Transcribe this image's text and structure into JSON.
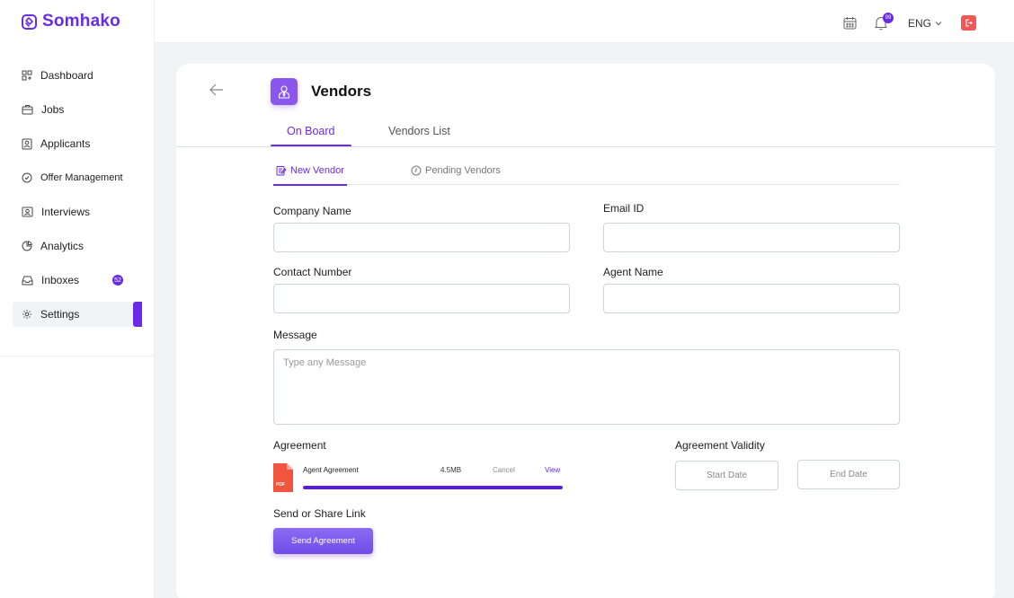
{
  "brand": {
    "name": "Somhako",
    "color": "#6A2BE8"
  },
  "sidebar": {
    "items": [
      {
        "label": "Dashboard",
        "icon": "dashboard-icon"
      },
      {
        "label": "Jobs",
        "icon": "briefcase-icon"
      },
      {
        "label": "Applicants",
        "icon": "applicants-icon"
      },
      {
        "label": "Offer Management",
        "icon": "offer-icon"
      },
      {
        "label": "Interviews",
        "icon": "interviews-icon"
      },
      {
        "label": "Analytics",
        "icon": "analytics-icon"
      },
      {
        "label": "Inboxes",
        "icon": "inbox-icon",
        "badge": "52"
      },
      {
        "label": "Settings",
        "icon": "gear-icon",
        "active": true
      }
    ]
  },
  "header": {
    "notification_count": "99",
    "language": "ENG"
  },
  "page": {
    "title": "Vendors",
    "tabs": [
      {
        "label": "On Board",
        "active": true
      },
      {
        "label": "Vendors List",
        "active": false
      }
    ],
    "subtabs": [
      {
        "label": "New Vendor",
        "active": true
      },
      {
        "label": "Pending Vendors",
        "active": false
      }
    ]
  },
  "form": {
    "company_name_label": "Company Name",
    "email_label": "Email ID",
    "contact_label": "Contact Number",
    "agent_label": "Agent Name",
    "message_label": "Message",
    "message_placeholder": "Type any Message",
    "agreement_label": "Agreement",
    "validity_label": "Agreement  Validity",
    "file": {
      "name": "Agent Agreement",
      "size": "4.5MB",
      "cancel": "Cancel",
      "view": "View",
      "type_label": "PDF",
      "progress": 1.0
    },
    "start_date": "Start Date",
    "end_date": "End Date",
    "share_label": "Send or Share Link",
    "send_button": "Send Agreement"
  }
}
